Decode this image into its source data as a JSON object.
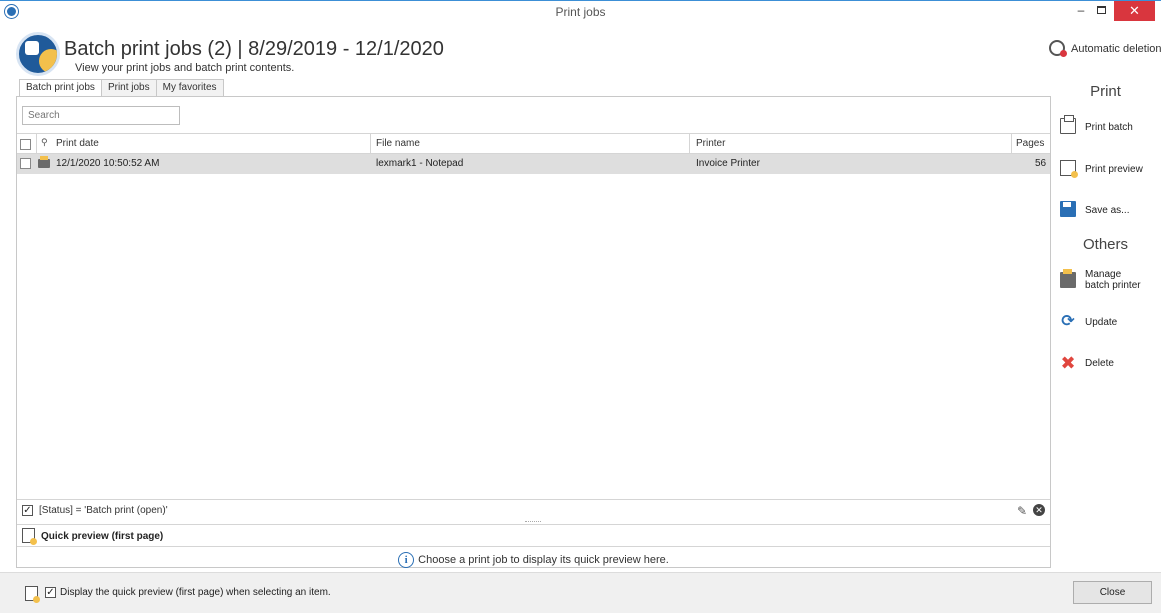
{
  "window": {
    "title": "Print jobs",
    "minimize_glyph": "–",
    "close_glyph": "✕"
  },
  "header": {
    "title": "Batch print jobs (2) | 8/29/2019 - 12/1/2020",
    "subtitle": "View your print jobs and batch print contents.",
    "auto_deletion_label": "Automatic deletion"
  },
  "tabs": [
    {
      "label": "Batch print jobs",
      "active": true
    },
    {
      "label": "Print jobs",
      "active": false
    },
    {
      "label": "My favorites",
      "active": false
    }
  ],
  "search": {
    "placeholder": "Search"
  },
  "grid": {
    "columns": {
      "print_date": "Print date",
      "file_name": "File name",
      "printer": "Printer",
      "pages": "Pages"
    },
    "rows": [
      {
        "print_date": "12/1/2020 10:50:52 AM",
        "file_name": "lexmark1 - Notepad",
        "printer": "Invoice Printer",
        "pages": "56"
      }
    ]
  },
  "filter": {
    "text": "[Status] = 'Batch print (open)'",
    "checked": true
  },
  "preview": {
    "header": "Quick preview (first page)",
    "message": "Choose a print job to display its quick preview here.",
    "info_glyph": "i"
  },
  "sidebar": {
    "print_heading": "Print",
    "others_heading": "Others",
    "print_batch": "Print batch",
    "print_preview": "Print preview",
    "save_as": "Save as...",
    "manage_line1": "Manage",
    "manage_line2": "batch printer",
    "update": "Update",
    "delete": "Delete",
    "update_glyph": "⟳",
    "delete_glyph": "✖"
  },
  "footer": {
    "checkbox_label": "Display the quick preview (first page) when selecting an item.",
    "checked": true,
    "close_label": "Close"
  },
  "colors": {
    "accent": "#2a6fb5",
    "close_red": "#d9363e",
    "selected_row": "#dedede",
    "yellow": "#f3c04c"
  }
}
